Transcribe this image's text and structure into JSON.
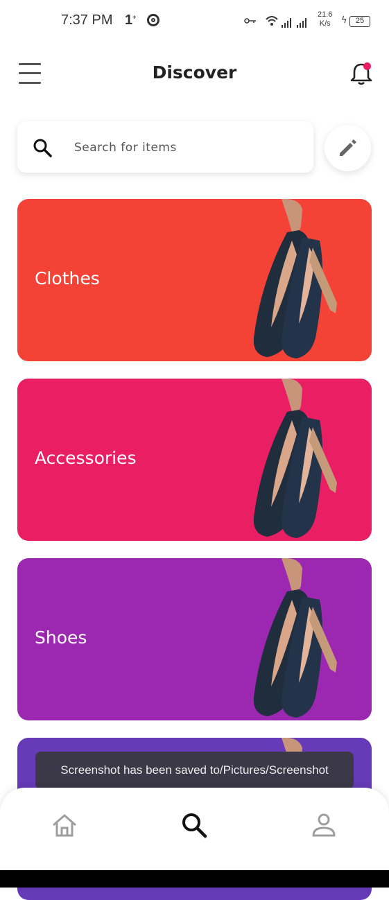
{
  "status_bar": {
    "time": "7:37 PM",
    "net_speed_value": "21.6",
    "net_speed_unit": "K/s",
    "battery": "25"
  },
  "app_bar": {
    "title": "Discover",
    "menu_icon": "hamburger-menu-icon",
    "notification_icon": "bell-icon",
    "notification_dot_color": "#e91e63"
  },
  "search": {
    "placeholder": "Search for items",
    "icon": "search-icon",
    "edit_icon": "pencil-icon"
  },
  "categories": [
    {
      "label": "Clothes",
      "color": "#f44336"
    },
    {
      "label": "Accessories",
      "color": "#e91e63"
    },
    {
      "label": "Shoes",
      "color": "#9c27b0"
    },
    {
      "label": "",
      "color": "#673ab7"
    }
  ],
  "toast": {
    "message": "Screenshot has been saved to/Pictures/Screenshot"
  },
  "bottom_nav": {
    "items": [
      {
        "icon": "home-icon",
        "active": false
      },
      {
        "icon": "search-icon",
        "active": true
      },
      {
        "icon": "person-icon",
        "active": false
      }
    ]
  }
}
